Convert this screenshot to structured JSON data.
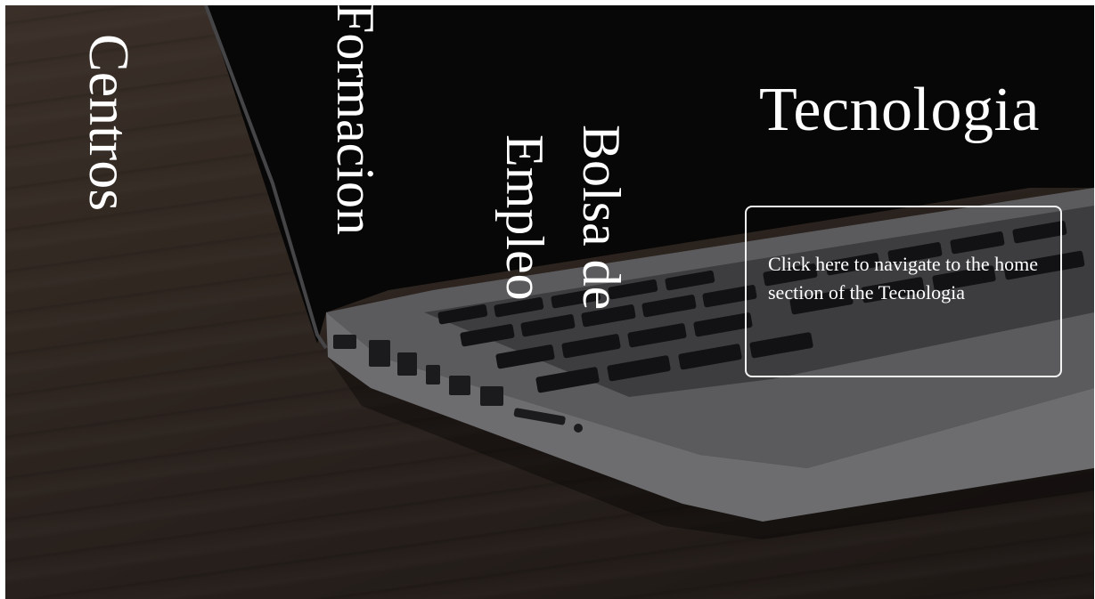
{
  "nav": {
    "centros": "Centros",
    "formacion": "Formacion",
    "empleo": "Bolsa de Empleo",
    "empleo_line1": "Empleo",
    "empleo_line2": "de",
    "bolsa": "Bolsa"
  },
  "header": {
    "title": "Tecnologia"
  },
  "home_link": {
    "text": "Click here to navigate to the home section of the Tecnologia"
  },
  "colors": {
    "text": "#ffffff",
    "screen": "#0d0c0c",
    "laptop_body": "#8f8f92",
    "desk": "#4a3c33"
  }
}
